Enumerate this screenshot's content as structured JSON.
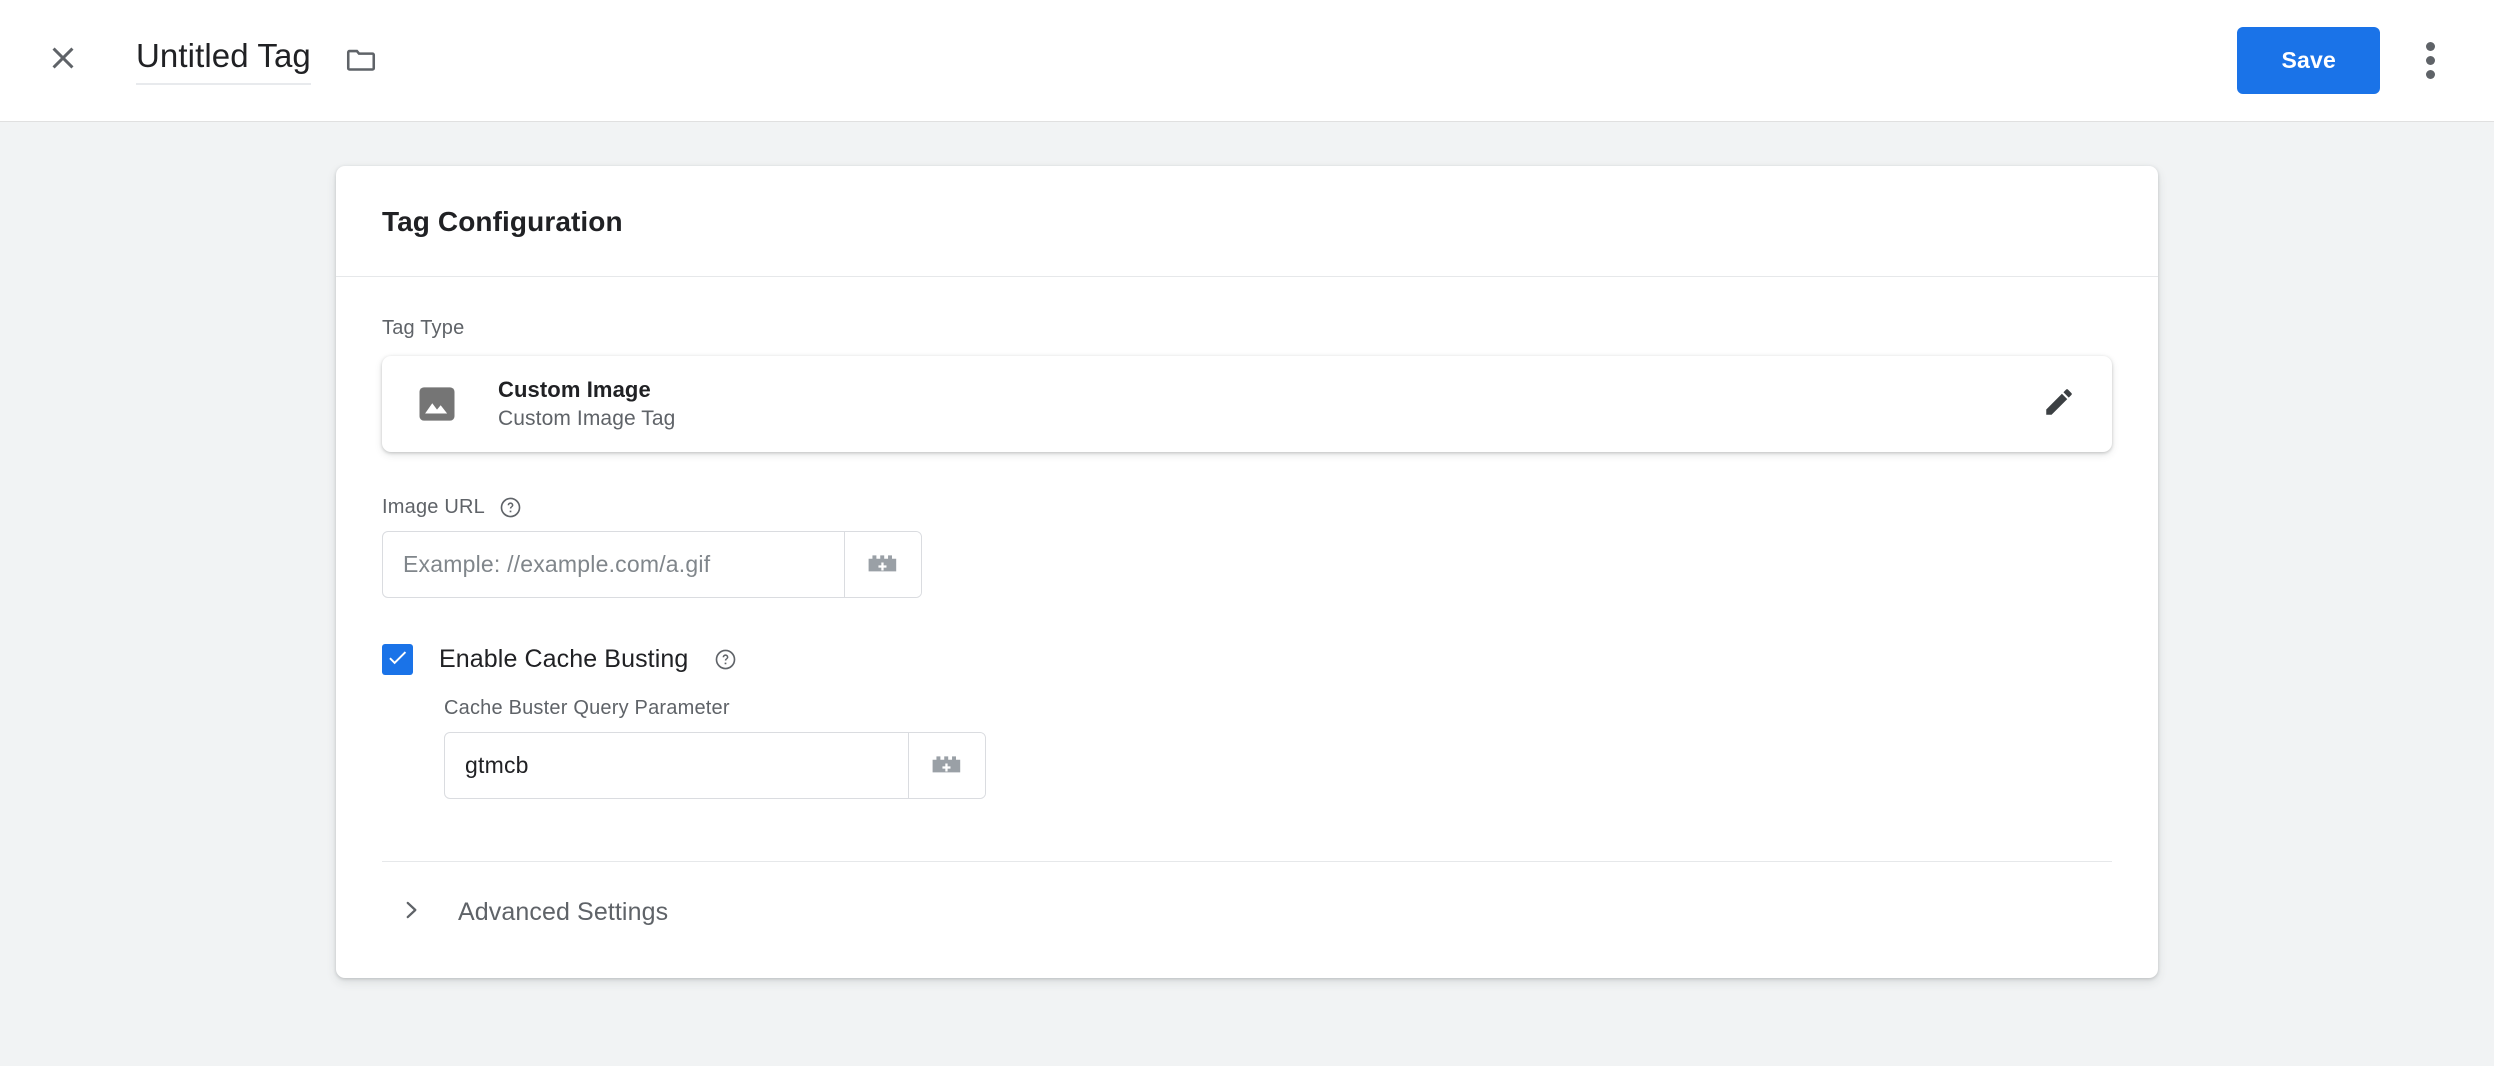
{
  "appbar": {
    "close_icon": "close-icon",
    "title": "Untitled Tag",
    "folder_icon": "folder-icon",
    "save_label": "Save",
    "more_icon": "more-vert-icon"
  },
  "card": {
    "header_title": "Tag Configuration",
    "tag_type": {
      "label": "Tag Type",
      "icon": "image-icon",
      "name": "Custom Image",
      "description": "Custom Image Tag",
      "edit_icon": "pencil-icon"
    },
    "image_url": {
      "label": "Image URL",
      "help_icon": "help-circle-icon",
      "value": "",
      "placeholder": "Example: //example.com/a.gif",
      "variable_icon": "insert-variable-icon"
    },
    "cache_busting": {
      "label": "Enable Cache Busting",
      "checked": true,
      "check_icon": "checkmark-icon",
      "help_icon": "help-circle-icon",
      "param_label": "Cache Buster Query Parameter",
      "param_value": "gtmcb",
      "param_placeholder": "",
      "variable_icon": "insert-variable-icon"
    },
    "advanced": {
      "label": "Advanced Settings",
      "chevron_icon": "chevron-right-icon"
    }
  },
  "colors": {
    "accent": "#1a73e8",
    "page_background": "#f1f3f4",
    "surface": "#ffffff",
    "text_primary": "#202124",
    "text_secondary": "#5f6368",
    "icon_gray": "#757575",
    "border": "#dadce0"
  }
}
